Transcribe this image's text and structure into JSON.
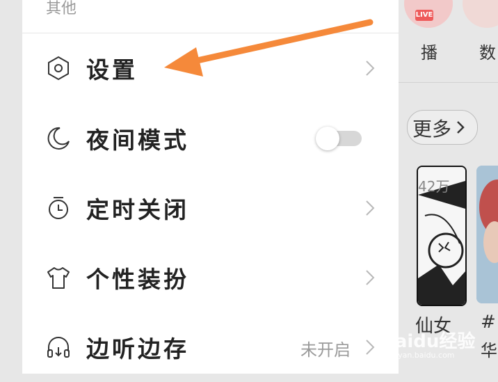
{
  "section": {
    "title": "其他"
  },
  "menu": {
    "items": [
      {
        "label": "设置",
        "icon": "settings-hexagon-icon",
        "trailing": "chevron"
      },
      {
        "label": "夜间模式",
        "icon": "moon-icon",
        "trailing": "toggle",
        "toggle_on": false
      },
      {
        "label": "定时关闭",
        "icon": "timer-icon",
        "trailing": "chevron"
      },
      {
        "label": "个性装扮",
        "icon": "tshirt-icon",
        "trailing": "chevron"
      },
      {
        "label": "边听边存",
        "icon": "headphones-download-icon",
        "trailing": "value-chevron",
        "value": "未开启"
      }
    ]
  },
  "background": {
    "live_badge": "LIVE",
    "category1": "播",
    "category2": "数",
    "more_label": "更多",
    "card1_count": "42万",
    "card1_title": "仙女",
    "card2_title": "#",
    "card2_subtitle": "华"
  },
  "watermark": {
    "brand": "Baidu经验",
    "url": "jingyan.baidu.com"
  },
  "colors": {
    "arrow": "#f5893a",
    "toggle_track": "#d7d7d7",
    "chevron": "#b8b8b8"
  }
}
